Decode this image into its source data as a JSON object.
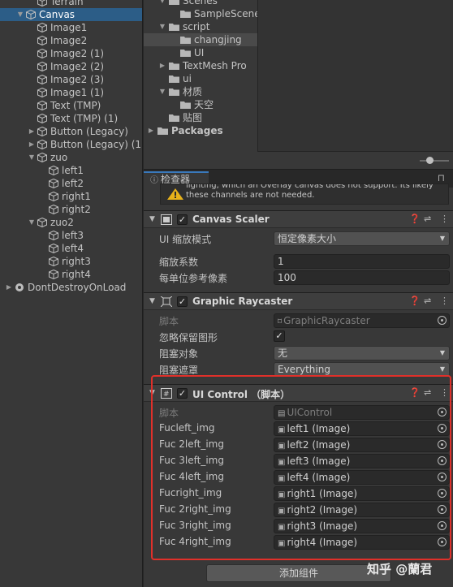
{
  "hierarchy": {
    "items": [
      {
        "label": "Terrain",
        "indent": 2,
        "arrow": "",
        "selected": false,
        "icon": "cube-icon"
      },
      {
        "label": "Canvas",
        "indent": 1,
        "arrow": "▼",
        "selected": true,
        "icon": "cube-icon"
      },
      {
        "label": "Image1",
        "indent": 2,
        "arrow": "",
        "selected": false,
        "icon": "cube-icon"
      },
      {
        "label": "Image2",
        "indent": 2,
        "arrow": "",
        "selected": false,
        "icon": "cube-icon"
      },
      {
        "label": "Image2 (1)",
        "indent": 2,
        "arrow": "",
        "selected": false,
        "icon": "cube-icon"
      },
      {
        "label": "Image2 (2)",
        "indent": 2,
        "arrow": "",
        "selected": false,
        "icon": "cube-icon"
      },
      {
        "label": "Image2 (3)",
        "indent": 2,
        "arrow": "",
        "selected": false,
        "icon": "cube-icon"
      },
      {
        "label": "Image1 (1)",
        "indent": 2,
        "arrow": "",
        "selected": false,
        "icon": "cube-icon"
      },
      {
        "label": "Text (TMP)",
        "indent": 2,
        "arrow": "",
        "selected": false,
        "icon": "cube-icon"
      },
      {
        "label": "Text (TMP) (1)",
        "indent": 2,
        "arrow": "",
        "selected": false,
        "icon": "cube-icon"
      },
      {
        "label": "Button (Legacy)",
        "indent": 2,
        "arrow": "▶",
        "selected": false,
        "icon": "cube-icon"
      },
      {
        "label": "Button (Legacy) (1)",
        "indent": 2,
        "arrow": "▶",
        "selected": false,
        "icon": "cube-icon"
      },
      {
        "label": "zuo",
        "indent": 2,
        "arrow": "▼",
        "selected": false,
        "icon": "cube-icon"
      },
      {
        "label": "left1",
        "indent": 3,
        "arrow": "",
        "selected": false,
        "icon": "cube-icon"
      },
      {
        "label": "left2",
        "indent": 3,
        "arrow": "",
        "selected": false,
        "icon": "cube-icon"
      },
      {
        "label": "right1",
        "indent": 3,
        "arrow": "",
        "selected": false,
        "icon": "cube-icon"
      },
      {
        "label": "right2",
        "indent": 3,
        "arrow": "",
        "selected": false,
        "icon": "cube-icon"
      },
      {
        "label": "zuo2",
        "indent": 2,
        "arrow": "▼",
        "selected": false,
        "icon": "cube-icon"
      },
      {
        "label": "left3",
        "indent": 3,
        "arrow": "",
        "selected": false,
        "icon": "cube-icon"
      },
      {
        "label": "left4",
        "indent": 3,
        "arrow": "",
        "selected": false,
        "icon": "cube-icon"
      },
      {
        "label": "right3",
        "indent": 3,
        "arrow": "",
        "selected": false,
        "icon": "cube-icon"
      },
      {
        "label": "right4",
        "indent": 3,
        "arrow": "",
        "selected": false,
        "icon": "cube-icon"
      },
      {
        "label": "DontDestroyOnLoad",
        "indent": 0,
        "arrow": "▶",
        "selected": false,
        "icon": "unity-scene-icon"
      }
    ]
  },
  "project": {
    "items": [
      {
        "label": "Scenes",
        "indent": 1,
        "arrow": "▼",
        "bold": false
      },
      {
        "label": "SampleScene",
        "indent": 2,
        "arrow": "",
        "bold": false
      },
      {
        "label": "script",
        "indent": 1,
        "arrow": "▼",
        "bold": false
      },
      {
        "label": "changjing",
        "indent": 2,
        "arrow": "",
        "bold": false,
        "selected": true
      },
      {
        "label": "UI",
        "indent": 2,
        "arrow": "",
        "bold": false
      },
      {
        "label": "TextMesh Pro",
        "indent": 1,
        "arrow": "▶",
        "bold": false
      },
      {
        "label": "ui",
        "indent": 1,
        "arrow": "",
        "bold": false
      },
      {
        "label": "材质",
        "indent": 1,
        "arrow": "▼",
        "bold": false
      },
      {
        "label": "天空",
        "indent": 2,
        "arrow": "",
        "bold": false
      },
      {
        "label": "贴图",
        "indent": 1,
        "arrow": "",
        "bold": false
      },
      {
        "label": "Packages",
        "indent": 0,
        "arrow": "▶",
        "bold": true
      }
    ]
  },
  "inspector": {
    "tab_label": "检查器",
    "warning_text": "lighting, which an Overlay canvas does not support. Its likely these channels are not needed.",
    "canvas_scaler": {
      "title": "Canvas Scaler",
      "fields": [
        {
          "label": "UI 缩放模式",
          "value": "恒定像素大小",
          "kind": "dropdown"
        },
        {
          "label": "缩放系数",
          "value": "1",
          "kind": "text"
        },
        {
          "label": "每单位参考像素",
          "value": "100",
          "kind": "text"
        }
      ]
    },
    "graphic_raycaster": {
      "title": "Graphic Raycaster",
      "fields": [
        {
          "label": "脚本",
          "value": "GraphicRaycaster",
          "kind": "object-dim"
        },
        {
          "label": "忽略保留图形",
          "value": "✓",
          "kind": "checkbox"
        },
        {
          "label": "阻塞对象",
          "value": "无",
          "kind": "dropdown"
        },
        {
          "label": "阻塞遮罩",
          "value": "Everything",
          "kind": "dropdown"
        }
      ]
    },
    "ui_control": {
      "title": "UI Control （脚本）",
      "fields": [
        {
          "label": "脚本",
          "value": "UIControl",
          "kind": "object-dim"
        },
        {
          "label": "Fucleft_img",
          "value": "left1 (Image)",
          "kind": "object"
        },
        {
          "label": "Fuc 2left_img",
          "value": "left2 (Image)",
          "kind": "object"
        },
        {
          "label": "Fuc 3left_img",
          "value": "left3 (Image)",
          "kind": "object"
        },
        {
          "label": "Fuc 4left_img",
          "value": "left4 (Image)",
          "kind": "object"
        },
        {
          "label": "Fucright_img",
          "value": "right1 (Image)",
          "kind": "object"
        },
        {
          "label": "Fuc 2right_img",
          "value": "right2 (Image)",
          "kind": "object"
        },
        {
          "label": "Fuc 3right_img",
          "value": "right3 (Image)",
          "kind": "object"
        },
        {
          "label": "Fuc 4right_img",
          "value": "right4 (Image)",
          "kind": "object"
        }
      ]
    },
    "add_component_label": "添加组件"
  },
  "watermark": "知乎 @蘭君",
  "colors": {
    "selection": "#2c5d87",
    "highlight_box": "#e0302a",
    "tab_accent": "#3a79bb"
  }
}
